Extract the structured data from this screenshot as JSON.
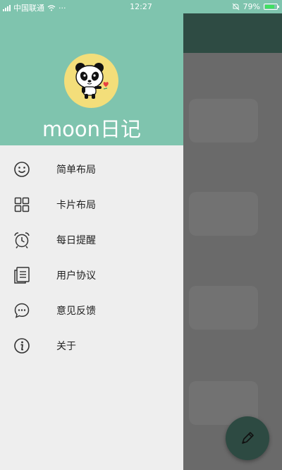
{
  "status_bar": {
    "carrier": "中国联通",
    "extra": "···",
    "time": "12:27",
    "battery_text": "79%",
    "battery_level": 0.79
  },
  "drawer": {
    "title": "moon日记",
    "header_color": "#7fc4ae",
    "menu": [
      {
        "label": "简单布局",
        "icon": "smiley-icon"
      },
      {
        "label": "卡片布局",
        "icon": "grid-layout-icon"
      },
      {
        "label": "每日提醒",
        "icon": "alarm-clock-icon"
      },
      {
        "label": "用户协议",
        "icon": "document-icon"
      },
      {
        "label": "意见反馈",
        "icon": "chat-bubble-icon"
      },
      {
        "label": "关于",
        "icon": "info-icon"
      }
    ]
  },
  "fab": {
    "icon": "pen-icon"
  }
}
